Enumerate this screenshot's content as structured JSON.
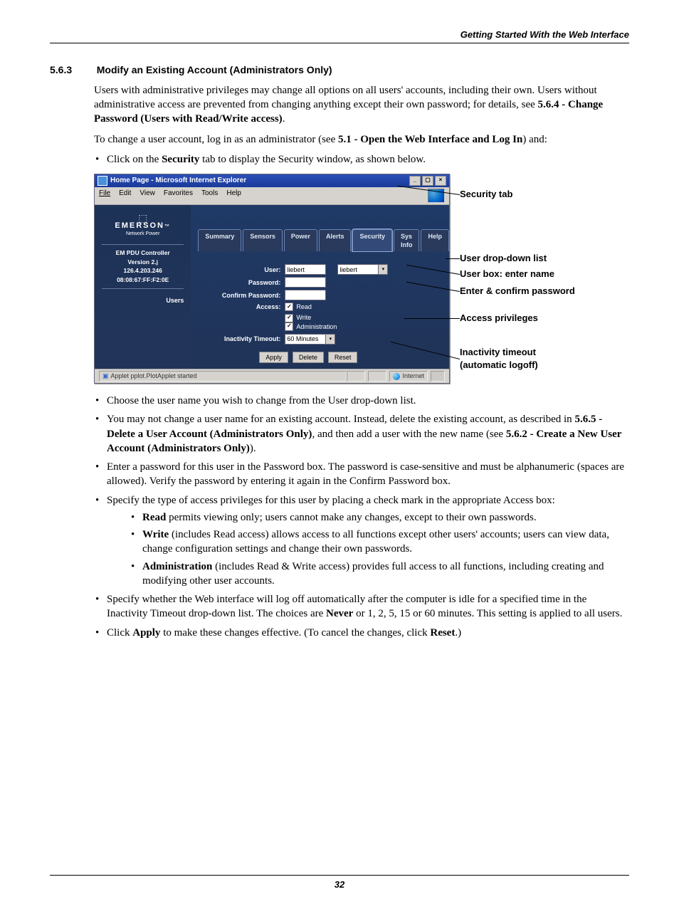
{
  "header": {
    "running_title": "Getting Started With the Web Interface"
  },
  "section": {
    "number": "5.6.3",
    "title": "Modify an Existing Account (Administrators Only)"
  },
  "paragraphs": {
    "p1_a": "Users with administrative privileges may change all options on all users' accounts, including their own. Users without administrative access are prevented from changing anything except their own password; for details, see ",
    "p1_ref": "5.6.4 - Change Password (Users with Read/Write access)",
    "p1_c": ".",
    "p2_a": "To change a user account, log in as an administrator (see ",
    "p2_ref": "5.1 - Open the Web Interface and Log In",
    "p2_c": ") and:",
    "bullet_intro_a": "Click on the ",
    "bullet_intro_b": "Security",
    "bullet_intro_c": " tab to display the Security window, as shown below."
  },
  "screenshot": {
    "window_title": "Home Page - Microsoft Internet Explorer",
    "menus": [
      "File",
      "Edit",
      "View",
      "Favorites",
      "Tools",
      "Help"
    ],
    "brand": {
      "name": "EMERSON",
      "sub": "Network Power"
    },
    "sidebar": {
      "lines": [
        "EM PDU Controller",
        "Version 2.j",
        "126.4.203.246",
        "08:08:67:FF:F2:0E"
      ],
      "section": "Users"
    },
    "tabs": [
      "Summary",
      "Sensors",
      "Power",
      "Alerts",
      "Security",
      "Sys Info",
      "Help"
    ],
    "form": {
      "user_label": "User:",
      "user_value": "liebert",
      "user_select_value": "liebert",
      "password_label": "Password:",
      "confirm_label": "Confirm Password:",
      "access_label": "Access:",
      "access_read": "Read",
      "access_write": "Write",
      "access_admin": "Administration",
      "timeout_label": "Inactivity Timeout:",
      "timeout_value": "60 Minutes",
      "btn_apply": "Apply",
      "btn_delete": "Delete",
      "btn_reset": "Reset"
    },
    "status": {
      "left": "Applet pplot.PlotApplet started",
      "right": "Internet"
    }
  },
  "callouts": {
    "c1": "Security tab",
    "c2": "User drop-down list",
    "c3": "User box: enter name",
    "c4": "Enter & confirm password",
    "c5": "Access privileges",
    "c6a": "Inactivity timeout",
    "c6b": "(automatic logoff)"
  },
  "below": {
    "b1": "Choose the user name you wish to change from the User drop-down list.",
    "b2_a": "You may not change a user name for an existing account. Instead, delete the existing account, as described in ",
    "b2_ref1": "5.6.5 - Delete a User Account (Administrators Only)",
    "b2_mid": ", and then add a user with the new name (see ",
    "b2_ref2": "5.6.2 - Create a New User Account (Administrators Only)",
    "b2_end": ").",
    "b3": "Enter a password for this user in the Password box. The password is case-sensitive and must be alphanumeric (spaces are allowed). Verify the password by entering it again in the Confirm Password box.",
    "b4": "Specify the type of access privileges for this user by placing a check mark in the appropriate Access box:",
    "s1_b": "Read",
    "s1_t": " permits viewing only; users cannot make any changes, except to their own passwords.",
    "s2_b": "Write",
    "s2_t": " (includes Read access) allows access to all functions except other users' accounts; users can view data, change configuration settings and change their own passwords.",
    "s3_b": "Administration",
    "s3_t": " (includes Read & Write access) provides full access to all functions, including creating and modifying other user accounts.",
    "b5_a": "Specify whether the Web interface will log off automatically after the computer is idle for a specified time in the Inactivity Timeout drop-down list. The choices are ",
    "b5_never": "Never",
    "b5_c": " or 1, 2, 5, 15 or 60 minutes. This setting is applied to all users.",
    "b6_a": "Click ",
    "b6_apply": "Apply",
    "b6_mid": " to make these changes effective. (To cancel the changes, click ",
    "b6_reset": "Reset",
    "b6_end": ".)"
  },
  "page_number": "32"
}
